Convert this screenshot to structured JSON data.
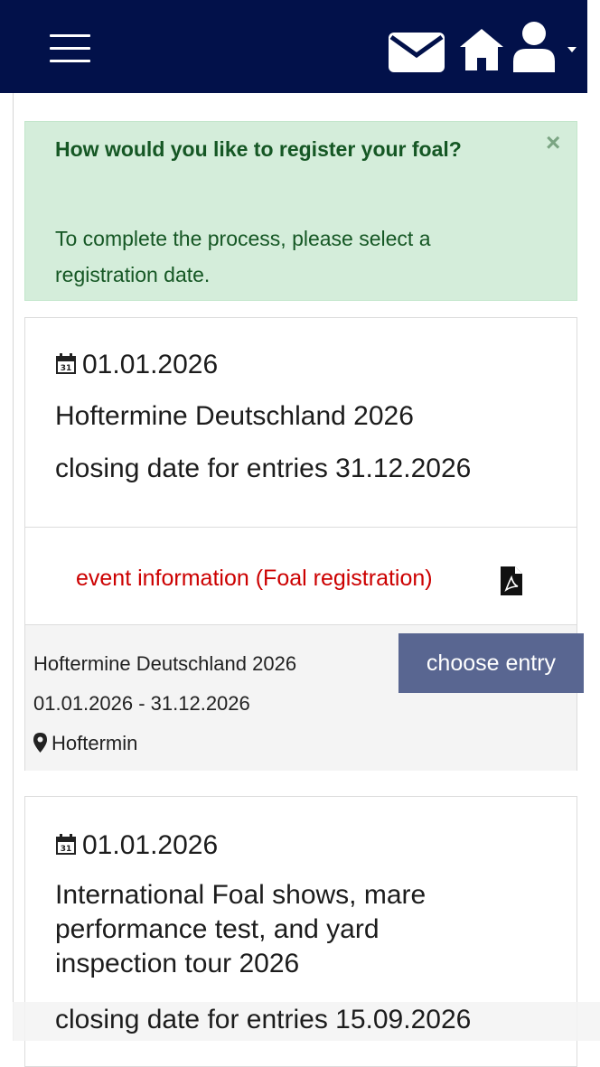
{
  "navbar": {
    "menu_icon": "hamburger-icon",
    "icons": [
      "envelope-icon",
      "home-icon",
      "user-icon",
      "caret-down-icon"
    ],
    "background": "#02114a"
  },
  "alert": {
    "title": "How would you like to register your foal?",
    "text": "To complete the process, please select a registration date.",
    "close": "×",
    "background": "#d4edda",
    "text_color": "#155724"
  },
  "events": [
    {
      "date": "01.01.2026",
      "title": "Hoftermine Deutschland 2026",
      "closing": "closing date for entries 31.12.2026",
      "info_link": "event information (Foal registration)",
      "entry_name": "Hoftermine Deutschland 2026",
      "entry_dates": "01.01.2026 - 31.12.2026",
      "entry_location": "Hoftermin",
      "button": "choose entry"
    },
    {
      "date": "01.01.2026",
      "title": "International Foal shows, mare performance test, and yard inspection tour 2026",
      "closing": "closing date for entries 15.09.2026"
    }
  ],
  "colors": {
    "button": "#596691",
    "link": "#cc0000"
  }
}
